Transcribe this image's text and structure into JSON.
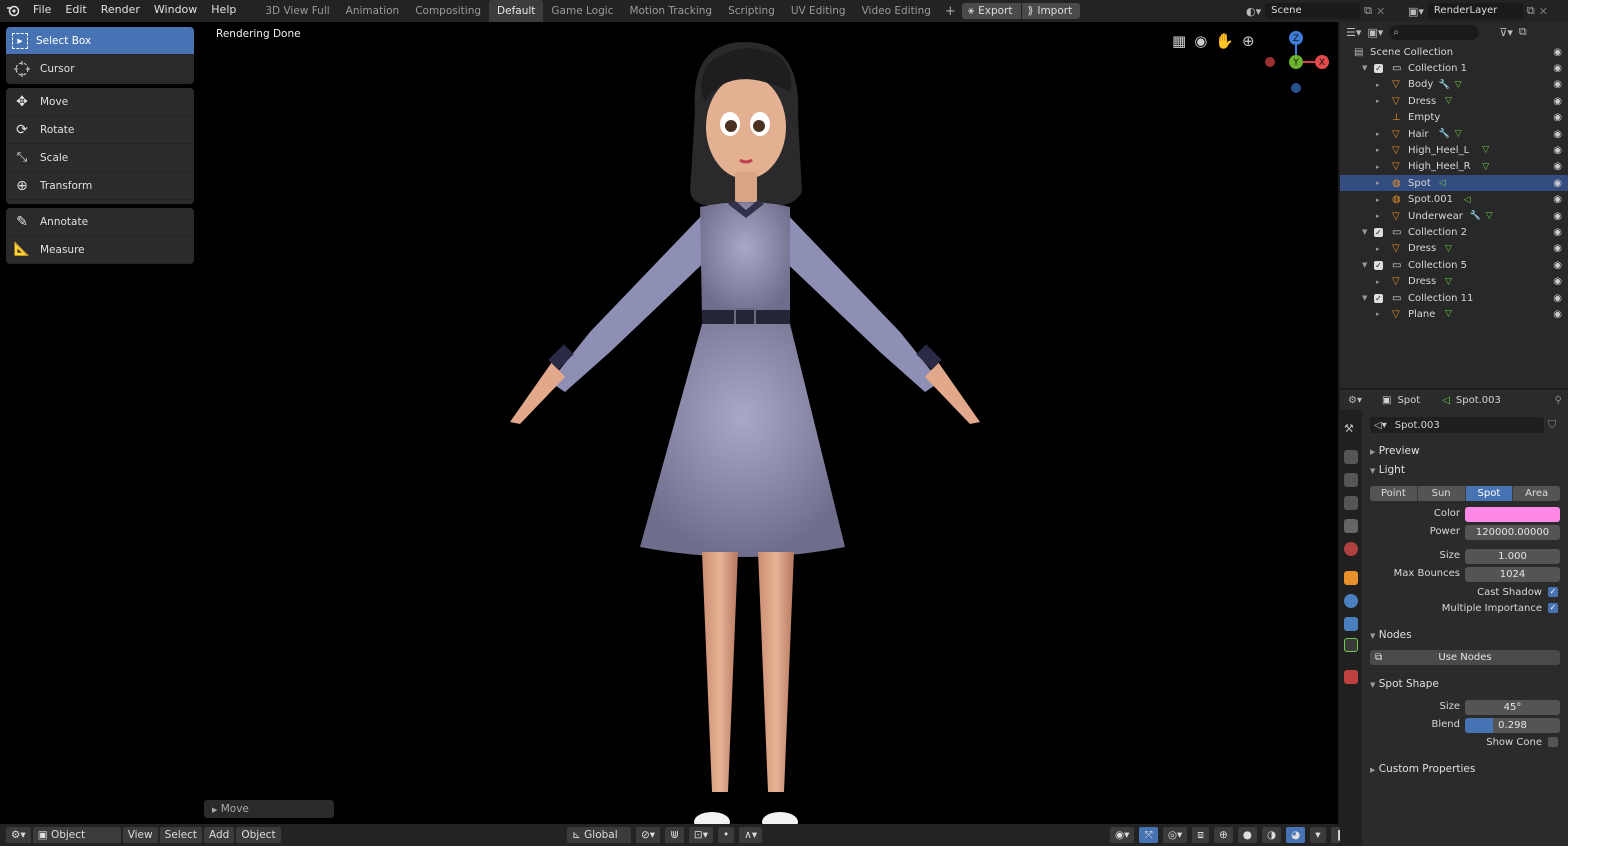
{
  "menu": {
    "file": "File",
    "edit": "Edit",
    "render": "Render",
    "window": "Window",
    "help": "Help"
  },
  "workspaces": [
    "3D View Full",
    "Animation",
    "Compositing",
    "Default",
    "Game Logic",
    "Motion Tracking",
    "Scripting",
    "UV Editing",
    "Video Editing"
  ],
  "active_workspace": "Default",
  "top_buttons": {
    "export": "Export",
    "import": "Import"
  },
  "scene": {
    "label": "Scene"
  },
  "renderlayer": {
    "label": "RenderLayer"
  },
  "viewport": {
    "status": "Rendering Done"
  },
  "toolbar": {
    "select_box": "Select Box",
    "cursor": "Cursor",
    "move": "Move",
    "rotate": "Rotate",
    "scale": "Scale",
    "transform": "Transform",
    "annotate": "Annotate",
    "measure": "Measure"
  },
  "operator_panel": {
    "label": "Move"
  },
  "bottombar": {
    "mode": "Object Mode",
    "view": "View",
    "select": "Select",
    "add": "Add",
    "object": "Object",
    "orientation": "Global"
  },
  "gizmo": {
    "z": "Z",
    "y": "Y",
    "x": "X"
  },
  "outliner": {
    "search_placeholder": "",
    "rows": [
      {
        "label": "Scene Collection"
      },
      {
        "label": "Collection 1"
      },
      {
        "label": "Body"
      },
      {
        "label": "Dress"
      },
      {
        "label": "Empty"
      },
      {
        "label": "Hair"
      },
      {
        "label": "High_Heel_L"
      },
      {
        "label": "High_Heel_R"
      },
      {
        "label": "Spot"
      },
      {
        "label": "Spot.001"
      },
      {
        "label": "Underwear"
      },
      {
        "label": "Collection 2"
      },
      {
        "label": "Dress"
      },
      {
        "label": "Collection 5"
      },
      {
        "label": "Dress"
      },
      {
        "label": "Collection 11"
      },
      {
        "label": "Plane"
      }
    ]
  },
  "properties": {
    "object": "Spot",
    "data": "Spot.003",
    "datablock": "Spot.003",
    "preview": "Preview",
    "light": "Light",
    "light_types": [
      "Point",
      "Sun",
      "Spot",
      "Area"
    ],
    "color_label": "Color",
    "color_value": "#ff88e6",
    "power_label": "Power",
    "power": "120000.00000",
    "size_label": "Size",
    "size": "1.000",
    "max_bounces_label": "Max Bounces",
    "max_bounces": "1024",
    "cast_shadow": "Cast Shadow",
    "multiple_importance": "Multiple Importance",
    "nodes": "Nodes",
    "use_nodes": "Use Nodes",
    "spot_shape": "Spot Shape",
    "spot_size_label": "Size",
    "spot_size": "45°",
    "blend_label": "Blend",
    "blend": "0.298",
    "blend_fraction": 0.298,
    "show_cone": "Show Cone",
    "custom_properties": "Custom Properties"
  },
  "colors": {
    "accent": "#4772b3",
    "selection": "#334d80",
    "mesh_orange": "#e8902c",
    "vertex_green": "#6ec84b"
  }
}
